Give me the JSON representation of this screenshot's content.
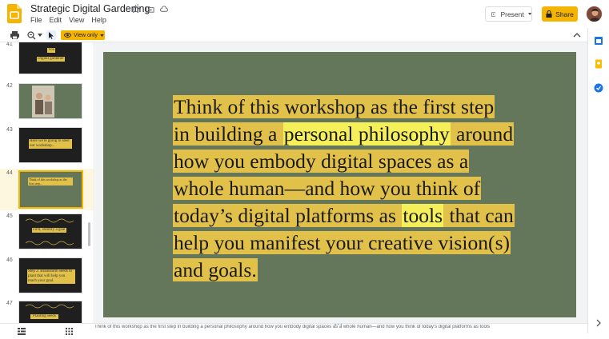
{
  "app": {
    "doc_title": "Strategic Digital Gardening",
    "menu": [
      "File",
      "Edit",
      "View",
      "Help"
    ],
    "present_label": "Present",
    "share_label": "Share"
  },
  "toolbar": {
    "mode_label": "View only"
  },
  "filmstrip": {
    "slides": [
      {
        "number": "41",
        "text": "You\nDigital gardener",
        "bg": "#1f1f1f"
      },
      {
        "number": "42",
        "text": "",
        "bg": "#64775a"
      },
      {
        "number": "43",
        "text": "Here we're going to steer our workshop...",
        "bg": "#1f1f1f"
      },
      {
        "number": "44",
        "text": "Think of this workshop as the first step...",
        "bg": "#64775a"
      },
      {
        "number": "45",
        "text": "First, identify a goal",
        "bg": "#1f1f1f"
      },
      {
        "number": "46",
        "text": "Step 2: Brainstorm seeds to plant that will help you reach your goal.",
        "bg": "#1f1f1f"
      },
      {
        "number": "47",
        "text": "\"Planting seeds\"",
        "bg": "#1f1f1f"
      }
    ],
    "active_number": "44"
  },
  "slide": {
    "lines": [
      {
        "parts": [
          {
            "t": "Think of this workshop as the first step",
            "hl": "gold"
          }
        ]
      },
      {
        "parts": [
          {
            "t": "in building a ",
            "hl": "gold"
          },
          {
            "t": "personal philosophy",
            "hl": "yellow"
          },
          {
            "t": " around",
            "hl": "gold"
          }
        ]
      },
      {
        "parts": [
          {
            "t": "how you embody digital spaces as a",
            "hl": "gold"
          }
        ]
      },
      {
        "parts": [
          {
            "t": "whole human—and how you think of",
            "hl": "gold"
          }
        ]
      },
      {
        "parts": [
          {
            "t": "today’s digital platforms as ",
            "hl": "gold"
          },
          {
            "t": "tools",
            "hl": "yellow"
          },
          {
            "t": " that can",
            "hl": "gold"
          }
        ]
      },
      {
        "parts": [
          {
            "t": "help you manifest your creative vision(s)",
            "hl": "gold"
          }
        ]
      },
      {
        "parts": [
          {
            "t": "and goals.",
            "hl": "gold"
          }
        ]
      }
    ]
  },
  "speaker_notes": "Think of this workshop as the first step in building a personal philosophy around how you embody digital spaces as a whole human—and how you think of today’s digital platforms as tools",
  "colors": {
    "accent": "#f4b400",
    "slide_bg": "#64775a",
    "highlight_gold": "#e2c14a",
    "highlight_yellow": "#f5f05a"
  }
}
